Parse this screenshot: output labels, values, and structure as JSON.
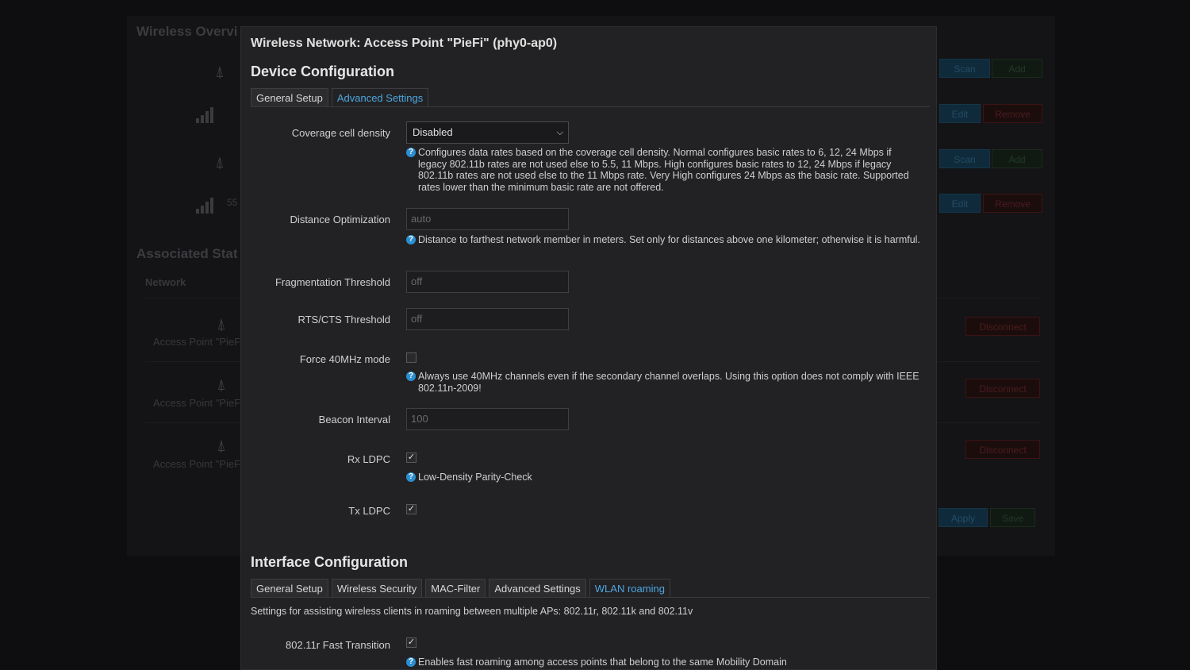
{
  "background": {
    "title_overview": "Wireless Overvi",
    "title_associated": "Associated Stat",
    "network_col": "Network",
    "signal_text": "55",
    "ap_label": "Access Point \"PieFi",
    "btn_scan": "Scan",
    "btn_add": "Add",
    "btn_edit": "Edit",
    "btn_remove": "Remove",
    "btn_disconnect": "Disconnect",
    "btn_apply": "Apply",
    "btn_save": "Save"
  },
  "modal": {
    "title": "Wireless Network: Access Point \"PieFi\" (phy0-ap0)",
    "device_section": "Device Configuration",
    "device_tabs": [
      {
        "label": "General Setup"
      },
      {
        "label": "Advanced Settings"
      }
    ],
    "fields": {
      "coverage": {
        "label": "Coverage cell density",
        "value": "Disabled",
        "help": "Configures data rates based on the coverage cell density. Normal configures basic rates to 6, 12, 24 Mbps if legacy 802.11b rates are not used else to 5.5, 11 Mbps. High configures basic rates to 12, 24 Mbps if legacy 802.11b rates are not used else to the 11 Mbps rate. Very High configures 24 Mbps as the basic rate. Supported rates lower than the minimum basic rate are not offered."
      },
      "distance": {
        "label": "Distance Optimization",
        "placeholder": "auto",
        "help": "Distance to farthest network member in meters. Set only for distances above one kilometer; otherwise it is harmful."
      },
      "fragmentation": {
        "label": "Fragmentation Threshold",
        "placeholder": "off"
      },
      "rts": {
        "label": "RTS/CTS Threshold",
        "placeholder": "off"
      },
      "force40": {
        "label": "Force 40MHz mode",
        "checked": false,
        "help": "Always use 40MHz channels even if the secondary channel overlaps. Using this option does not comply with IEEE 802.11n-2009!"
      },
      "beacon": {
        "label": "Beacon Interval",
        "placeholder": "100"
      },
      "rxldpc": {
        "label": "Rx LDPC",
        "checked": true,
        "help": "Low-Density Parity-Check"
      },
      "txldpc": {
        "label": "Tx LDPC",
        "checked": true
      }
    },
    "interface_section": "Interface Configuration",
    "interface_tabs": [
      {
        "label": "General Setup"
      },
      {
        "label": "Wireless Security"
      },
      {
        "label": "MAC-Filter"
      },
      {
        "label": "Advanced Settings"
      },
      {
        "label": "WLAN roaming"
      }
    ],
    "roaming_desc": "Settings for assisting wireless clients in roaming between multiple APs: 802.11r, 802.11k and 802.11v",
    "fast_transition": {
      "label": "802.11r Fast Transition",
      "checked": true,
      "help": "Enables fast roaming among access points that belong to the same Mobility Domain"
    }
  },
  "icons": {
    "help": "question-circle-icon",
    "check": "check-icon",
    "chevron": "chevron-down-icon",
    "ap": "antenna-icon",
    "signal": "signal-bars-icon"
  },
  "colors": {
    "accent": "#4da6e0",
    "help_icon": "#2b8fd0",
    "modal_bg": "#222224",
    "page_bg": "#0b0b0c"
  }
}
